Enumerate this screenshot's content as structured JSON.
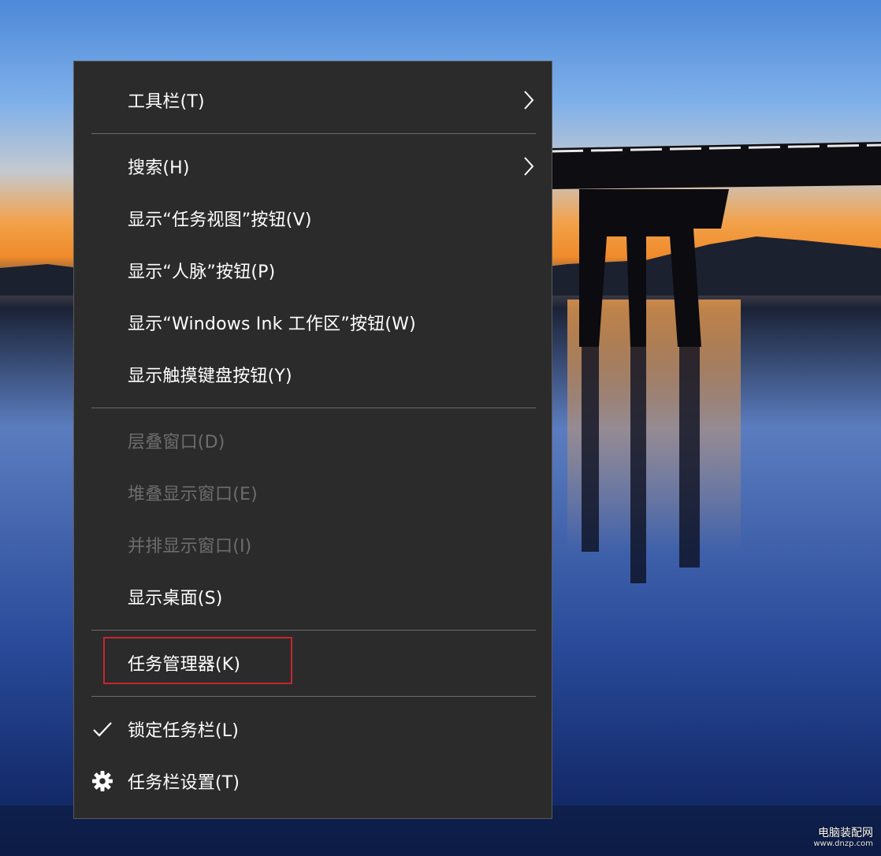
{
  "menu": {
    "items": [
      {
        "label": "工具栏(T)",
        "enabled": true,
        "submenu": true
      },
      {
        "label": "搜索(H)",
        "enabled": true,
        "submenu": true
      },
      {
        "label": "显示“任务视图”按钮(V)",
        "enabled": true
      },
      {
        "label": "显示“人脉”按钮(P)",
        "enabled": true
      },
      {
        "label": "显示“Windows Ink 工作区”按钮(W)",
        "enabled": true
      },
      {
        "label": "显示触摸键盘按钮(Y)",
        "enabled": true
      },
      {
        "label": "层叠窗口(D)",
        "enabled": false
      },
      {
        "label": "堆叠显示窗口(E)",
        "enabled": false
      },
      {
        "label": "并排显示窗口(I)",
        "enabled": false
      },
      {
        "label": "显示桌面(S)",
        "enabled": true
      },
      {
        "label": "任务管理器(K)",
        "enabled": true,
        "highlighted": true
      },
      {
        "label": "锁定任务栏(L)",
        "enabled": true,
        "checked": true,
        "icon": "checkmark-icon"
      },
      {
        "label": "任务栏设置(T)",
        "enabled": true,
        "icon": "gear-icon"
      }
    ]
  },
  "watermark": {
    "title": "电脑装配网",
    "url": "www.dnzp.com"
  },
  "colors": {
    "menu_bg": "#2b2b2b",
    "text": "#ffffff",
    "disabled_text": "#6d6d6d",
    "highlight_box": "#c5262d"
  }
}
